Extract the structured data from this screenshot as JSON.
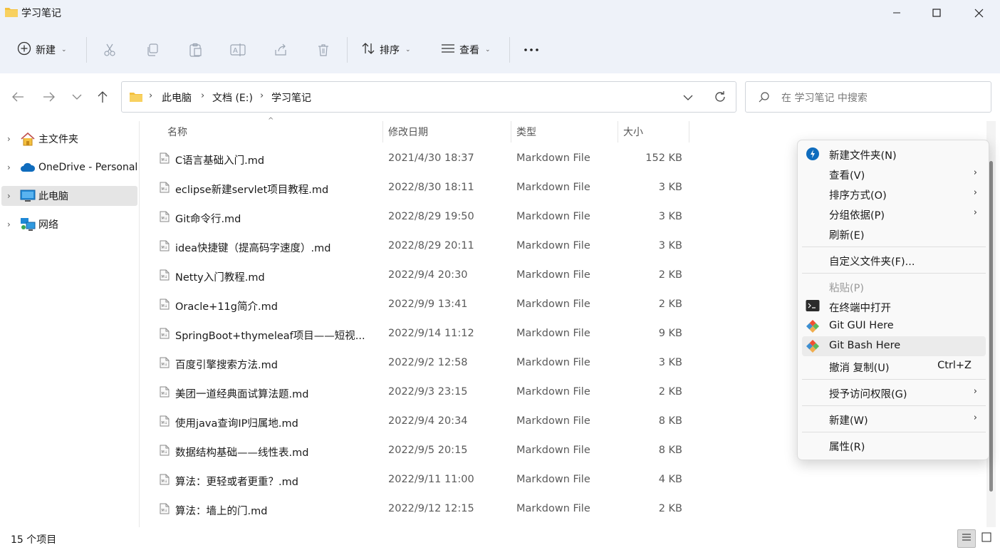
{
  "window": {
    "title": "学习笔记"
  },
  "toolbar": {
    "new_label": "新建",
    "sort_label": "排序",
    "view_label": "查看"
  },
  "address": {
    "crumbs": [
      "此电脑",
      "文档 (E:)",
      "学习笔记"
    ]
  },
  "search": {
    "placeholder": "在 学习笔记 中搜索"
  },
  "nav": {
    "items": [
      "主文件夹",
      "OneDrive - Personal",
      "此电脑",
      "网络"
    ]
  },
  "columns": {
    "name": "名称",
    "date": "修改日期",
    "type": "类型",
    "size": "大小"
  },
  "files": [
    {
      "name": "C语言基础入门.md",
      "date": "2021/4/30 18:37",
      "type": "Markdown File",
      "size": "152 KB"
    },
    {
      "name": "eclipse新建servlet项目教程.md",
      "date": "2022/8/30 18:11",
      "type": "Markdown File",
      "size": "3 KB"
    },
    {
      "name": "Git命令行.md",
      "date": "2022/8/29 19:50",
      "type": "Markdown File",
      "size": "3 KB"
    },
    {
      "name": "idea快捷键（提高码字速度）.md",
      "date": "2022/8/29 20:11",
      "type": "Markdown File",
      "size": "3 KB"
    },
    {
      "name": "Netty入门教程.md",
      "date": "2022/9/4 20:30",
      "type": "Markdown File",
      "size": "2 KB"
    },
    {
      "name": "Oracle+11g简介.md",
      "date": "2022/9/9 13:41",
      "type": "Markdown File",
      "size": "2 KB"
    },
    {
      "name": "SpringBoot+thymeleaf项目——短视...",
      "date": "2022/9/14 11:12",
      "type": "Markdown File",
      "size": "9 KB"
    },
    {
      "name": "百度引擎搜索方法.md",
      "date": "2022/9/2 12:58",
      "type": "Markdown File",
      "size": "3 KB"
    },
    {
      "name": "美团一道经典面试算法题.md",
      "date": "2022/9/3 23:15",
      "type": "Markdown File",
      "size": "2 KB"
    },
    {
      "name": "使用java查询IP归属地.md",
      "date": "2022/9/4 20:34",
      "type": "Markdown File",
      "size": "8 KB"
    },
    {
      "name": "数据结构基础——线性表.md",
      "date": "2022/9/5 20:15",
      "type": "Markdown File",
      "size": "8 KB"
    },
    {
      "name": "算法：更轻或者更重？.md",
      "date": "2022/9/11 11:00",
      "type": "Markdown File",
      "size": "4 KB"
    },
    {
      "name": "算法：墙上的门.md",
      "date": "2022/9/12 12:15",
      "type": "Markdown File",
      "size": "2 KB"
    }
  ],
  "context_menu": {
    "new_folder": "新建文件夹(N)",
    "view": "查看(V)",
    "sort_by": "排序方式(O)",
    "group_by": "分组依据(P)",
    "refresh": "刷新(E)",
    "customize": "自定义文件夹(F)...",
    "paste": "粘贴(P)",
    "open_terminal": "在终端中打开",
    "git_gui": "Git GUI Here",
    "git_bash": "Git Bash Here",
    "undo": "撤消 复制(U)",
    "undo_shortcut": "Ctrl+Z",
    "give_access": "授予访问权限(G)",
    "new": "新建(W)",
    "properties": "属性(R)"
  },
  "status": {
    "count": "15 个项目"
  },
  "colors": {
    "accent": "#0067c0",
    "folder": "#f4c03e",
    "menu_bg": "#f9f9f9"
  },
  "icons": [
    "folder-icon",
    "plus-icon",
    "cut-icon",
    "copy-icon",
    "paste-icon",
    "rename-icon",
    "share-icon",
    "delete-icon",
    "sort-icon",
    "view-icon",
    "more-icon",
    "home-icon",
    "cloud-icon",
    "pc-icon",
    "network-icon",
    "file-icon",
    "terminal-icon",
    "git-icon"
  ]
}
